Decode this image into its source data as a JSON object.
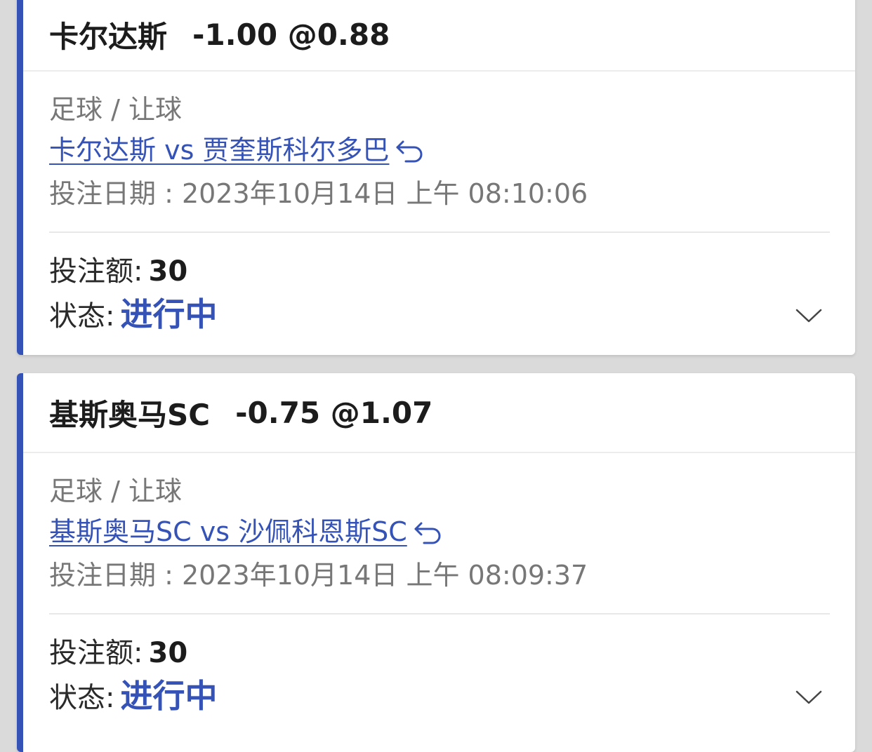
{
  "bets": [
    {
      "team": "卡尔达斯",
      "odds": "-1.00 @0.88",
      "sport": "足球 / 让球",
      "match": "卡尔达斯 vs 贾奎斯科尔多巴",
      "bet_date": "投注日期 : 2023年10月14日 上午 08:10:06",
      "stake_label": "投注额:",
      "stake_value": "30",
      "status_label": "状态:",
      "status_value": "进行中",
      "icons": {
        "return": "return-arrow-icon",
        "expand": "chevron-down-icon"
      }
    },
    {
      "team": "基斯奥马SC",
      "odds": "-0.75 @1.07",
      "sport": "足球 / 让球",
      "match": "基斯奥马SC vs 沙佩科恩斯SC",
      "bet_date": "投注日期 : 2023年10月14日 上午 08:09:37",
      "stake_label": "投注额:",
      "stake_value": "30",
      "status_label": "状态:",
      "status_value": "进行中",
      "icons": {
        "return": "return-arrow-icon",
        "expand": "chevron-down-icon"
      }
    }
  ],
  "colors": {
    "accent": "#3553b6",
    "background": "#dadada",
    "muted_text": "#777777"
  }
}
